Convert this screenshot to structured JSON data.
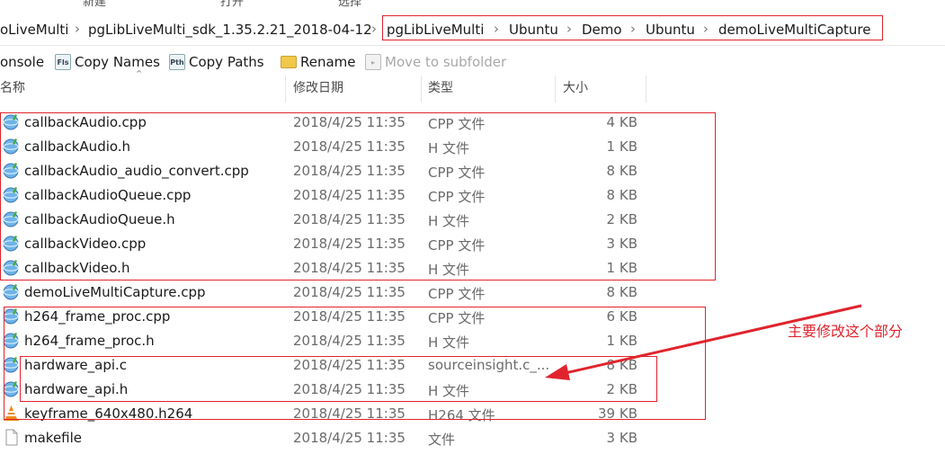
{
  "ribbon_groups": [
    "新建",
    "打开",
    "选择"
  ],
  "breadcrumb": [
    "oLiveMulti",
    "pgLibLiveMulti_sdk_1.35.2.21_2018-04-12",
    "pgLibLiveMulti",
    "Ubuntu",
    "Demo",
    "Ubuntu",
    "demoLiveMultiCapture"
  ],
  "toolbar": {
    "console": "onsole",
    "copy_names": "Copy Names",
    "copy_paths": "Copy Paths",
    "rename": "Rename",
    "move_to_subfolder": "Move to subfolder",
    "copy_names_icon": "copy-names-icon",
    "copy_paths_icon": "copy-paths-icon",
    "rename_icon": "rename-folder-icon",
    "move_icon": "move-to-subfolder-icon"
  },
  "columns": {
    "name": "名称",
    "date": "修改日期",
    "type": "类型",
    "size": "大小"
  },
  "files": [
    {
      "name": "callbackAudio.cpp",
      "date": "2018/4/25 11:35",
      "type": "CPP 文件",
      "size": "4 KB",
      "icon": "sourceinsight-file-icon"
    },
    {
      "name": "callbackAudio.h",
      "date": "2018/4/25 11:35",
      "type": "H 文件",
      "size": "1 KB",
      "icon": "sourceinsight-file-icon"
    },
    {
      "name": "callbackAudio_audio_convert.cpp",
      "date": "2018/4/25 11:35",
      "type": "CPP 文件",
      "size": "8 KB",
      "icon": "sourceinsight-file-icon"
    },
    {
      "name": "callbackAudioQueue.cpp",
      "date": "2018/4/25 11:35",
      "type": "CPP 文件",
      "size": "8 KB",
      "icon": "sourceinsight-file-icon"
    },
    {
      "name": "callbackAudioQueue.h",
      "date": "2018/4/25 11:35",
      "type": "H 文件",
      "size": "2 KB",
      "icon": "sourceinsight-file-icon"
    },
    {
      "name": "callbackVideo.cpp",
      "date": "2018/4/25 11:35",
      "type": "CPP 文件",
      "size": "3 KB",
      "icon": "sourceinsight-file-icon"
    },
    {
      "name": "callbackVideo.h",
      "date": "2018/4/25 11:35",
      "type": "H 文件",
      "size": "1 KB",
      "icon": "sourceinsight-file-icon"
    },
    {
      "name": "demoLiveMultiCapture.cpp",
      "date": "2018/4/25 11:35",
      "type": "CPP 文件",
      "size": "8 KB",
      "icon": "sourceinsight-file-icon"
    },
    {
      "name": "h264_frame_proc.cpp",
      "date": "2018/4/25 11:35",
      "type": "CPP 文件",
      "size": "6 KB",
      "icon": "sourceinsight-file-icon"
    },
    {
      "name": "h264_frame_proc.h",
      "date": "2018/4/25 11:35",
      "type": "H 文件",
      "size": "1 KB",
      "icon": "sourceinsight-file-icon"
    },
    {
      "name": "hardware_api.c",
      "date": "2018/4/25 11:35",
      "type": "sourceinsight.c_...",
      "size": "8 KB",
      "icon": "sourceinsight-file-icon"
    },
    {
      "name": "hardware_api.h",
      "date": "2018/4/25 11:35",
      "type": "H 文件",
      "size": "2 KB",
      "icon": "sourceinsight-file-icon"
    },
    {
      "name": "keyframe_640x480.h264",
      "date": "2018/4/25 11:35",
      "type": "H264 文件",
      "size": "39 KB",
      "icon": "vlc-cone-icon"
    },
    {
      "name": "makefile",
      "date": "2018/4/25 11:35",
      "type": "文件",
      "size": "3 KB",
      "icon": "blank-file-icon"
    }
  ],
  "annotation": {
    "text": "主要修改这个部分",
    "color": "#e0242d"
  },
  "colors": {
    "highlight": "#e0242d",
    "text": "#1a1a1a",
    "muted": "#6b6b6b"
  }
}
